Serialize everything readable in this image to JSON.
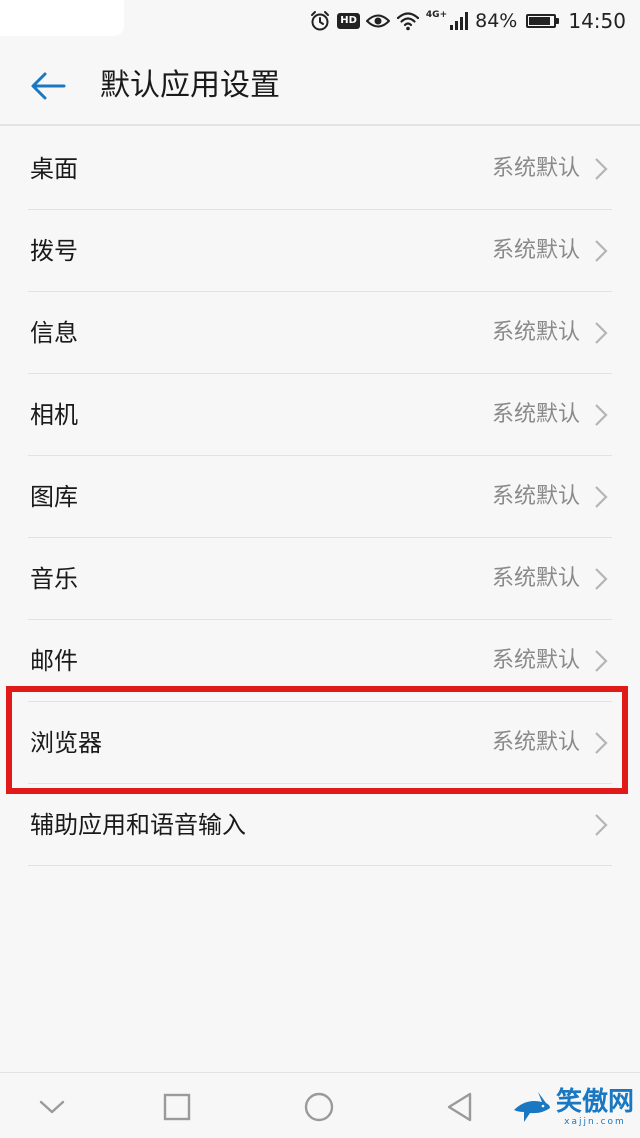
{
  "status_bar": {
    "hd_label": "HD",
    "network_label": "4G+",
    "battery_percent_text": "84%",
    "battery_level": 0.84,
    "time": "14:50"
  },
  "header": {
    "title": "默认应用设置",
    "back_icon": "arrow-left-icon",
    "accent_color": "#1a78c2"
  },
  "settings": {
    "items": [
      {
        "label": "桌面",
        "value": "系统默认"
      },
      {
        "label": "拨号",
        "value": "系统默认"
      },
      {
        "label": "信息",
        "value": "系统默认"
      },
      {
        "label": "相机",
        "value": "系统默认"
      },
      {
        "label": "图库",
        "value": "系统默认"
      },
      {
        "label": "音乐",
        "value": "系统默认"
      },
      {
        "label": "邮件",
        "value": "系统默认"
      },
      {
        "label": "浏览器",
        "value": "系统默认"
      },
      {
        "label": "辅助应用和语音输入",
        "value": ""
      }
    ]
  },
  "highlight": {
    "color": "#e01919"
  },
  "nav_bar": {
    "icons": [
      "chevron-down-icon",
      "square-icon",
      "circle-icon",
      "triangle-back-icon"
    ]
  },
  "watermark": {
    "text": "笑傲网",
    "subtext": "xajjn.com"
  }
}
